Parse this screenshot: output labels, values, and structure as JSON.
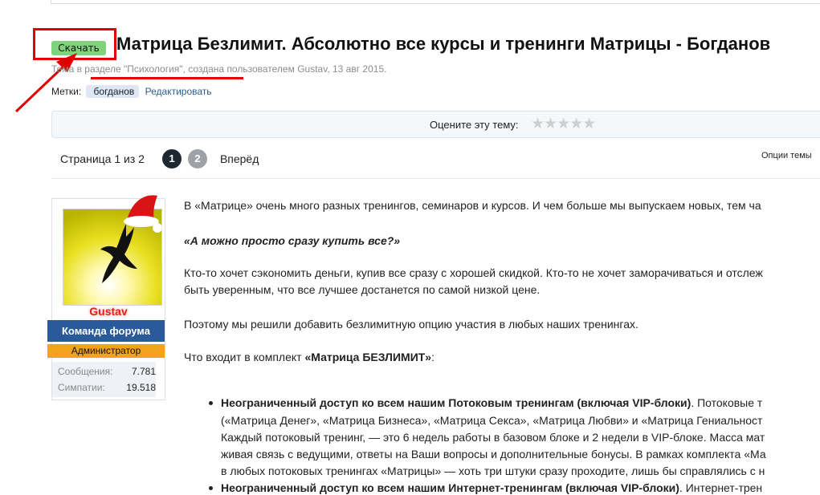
{
  "header": {
    "download_label": "Скачать",
    "thread_title": "Матрица Безлимит. Абсолютно все курсы и тренинги Матрицы - Богданов",
    "meta": "Тема в разделе \"Психология\", создана пользователем Gustav, 13 авг 2015.",
    "tags_label": "Метки:",
    "tag": "богданов",
    "tags_edit": "Редактировать"
  },
  "rating": {
    "prompt": "Оцените эту тему:",
    "stars": "★★★★★"
  },
  "pager": {
    "label": "Страница 1 из 2",
    "page1": "1",
    "page2": "2",
    "next": "Вперёд",
    "options": "Опции темы"
  },
  "user": {
    "name": "Gustav",
    "title": "Команда форума",
    "role": "Администратор",
    "messages_label": "Сообщения:",
    "messages_value": "7.781",
    "likes_label": "Симпатии:",
    "likes_value": "19.518"
  },
  "post": {
    "p1": "В «Матрице» очень много разных тренингов, семинаров и курсов. И чем больше мы выпускаем новых, тем ча",
    "p2": "«А можно просто сразу купить все?»",
    "p3a": "Кто-то хочет сэкономить деньги, купив все сразу с хорошей скидкой. Кто-то не хочет заморачиваться и отслеж",
    "p3b": "быть уверенным, что все лучшее достанется по самой низкой цене.",
    "p4": "Поэтому мы решили добавить безлимитную опцию участия в любых наших тренингах.",
    "p5_prefix": "Что входит в комплект ",
    "p5_bold": "«Матрица БЕЗЛИМИТ»",
    "p5_suffix": ":",
    "b1_bold": "Неограниченный доступ ко всем нашим Потоковым тренингам (включая VIP-блоки)",
    "b1_rest": ". Потоковые т",
    "b1_l2": "(«Матрица Денег», «Матрица Бизнеса», «Матрица Секса», «Матрица Любви» и «Матрица Гениальност",
    "b1_l3": "Каждый потоковый тренинг, — это 6 недель работы в базовом блоке и 2 недели в VIP-блоке. Масса мат",
    "b1_l4": "живая связь с ведущими, ответы на Ваши вопросы и дополнительные бонусы. В рамках комплекта «Ма",
    "b1_l5": "в любых потоковых тренингах «Матрицы» — хоть три штуки сразу проходите, лишь бы справлялись с н",
    "b2_bold": "Неограниченный доступ ко всем нашим Интернет-тренингам (включая VIP-блоки)",
    "b2_rest": ". Интернет-трен"
  },
  "colors": {
    "annotation": "#e00000",
    "download_button": "#7fd37a",
    "user_title_bg": "#2a5a9a",
    "role_bg": "#f2a21b"
  }
}
